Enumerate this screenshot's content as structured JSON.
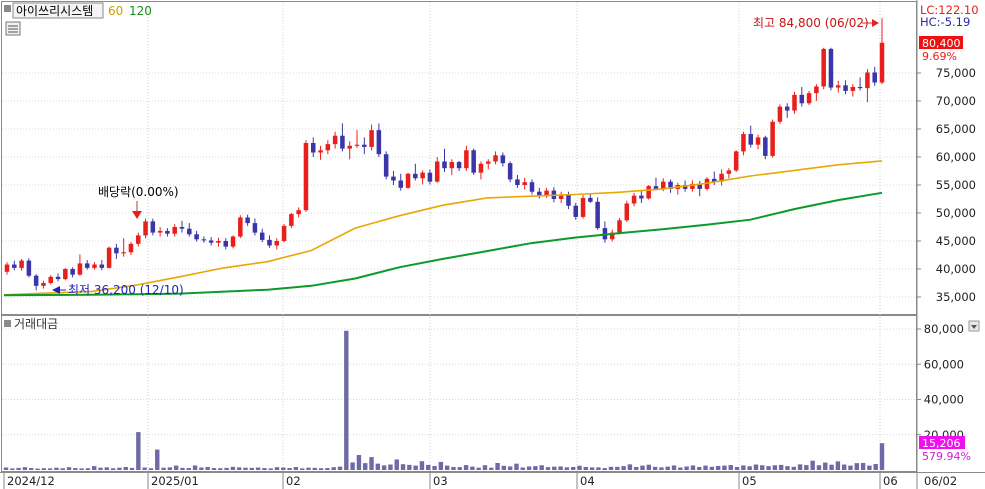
{
  "legend": {
    "stock_name": "아이쓰리시스템",
    "ma_short": "60",
    "ma_long": "120"
  },
  "price_panel": {
    "lc_label": "LC:122.10",
    "hc_label": "HC:-5.19",
    "current_price": "80,400",
    "change_pct": "9.69%",
    "high_annotation": "최고 84,800 (06/02)",
    "low_annotation": "최저 36,200 (12/10)",
    "dividend_annotation": "배당락(0.00%)"
  },
  "volume_panel": {
    "title": "거래대금",
    "current_value": "15,206",
    "change_pct": "579.94%"
  },
  "colors": {
    "up": "#e8201c",
    "down": "#3a35a8",
    "ma_short": "#e8a800",
    "ma_long": "#0c9a2a",
    "volume": "#6d6aa6",
    "highlight_price": "#ee1111",
    "highlight_volume": "#ee11ee"
  },
  "chart_data": {
    "type": "candlestick",
    "price_axis": {
      "ticks": [
        35000,
        40000,
        45000,
        50000,
        55000,
        60000,
        65000,
        70000,
        75000
      ],
      "tick_labels": [
        "35,000",
        "40,000",
        "45,000",
        "50,000",
        "55,000",
        "60,000",
        "65,000",
        "70,000",
        "75,000"
      ],
      "range": [
        33000,
        89000
      ]
    },
    "volume_axis": {
      "ticks": [
        20000,
        40000,
        60000,
        80000
      ],
      "tick_labels": [
        "20,000",
        "40,000",
        "60,000",
        "80,000"
      ],
      "range": [
        0,
        86000
      ]
    },
    "x_axis": {
      "labels": [
        "2024/12",
        "2025/01",
        "02",
        "03",
        "04",
        "05",
        "06",
        "06/02"
      ]
    },
    "candles": [
      [
        39500,
        41200,
        39000,
        40800
      ],
      [
        40800,
        41500,
        39800,
        40200
      ],
      [
        40200,
        41800,
        39700,
        41500
      ],
      [
        41500,
        41900,
        38500,
        38800
      ],
      [
        38800,
        39100,
        36200,
        37000
      ],
      [
        37000,
        37900,
        36500,
        37500
      ],
      [
        37500,
        38900,
        37200,
        38600
      ],
      [
        38600,
        39200,
        37800,
        38200
      ],
      [
        38200,
        40200,
        38000,
        40000
      ],
      [
        40000,
        40300,
        38500,
        39000
      ],
      [
        39000,
        42600,
        38800,
        41000
      ],
      [
        41000,
        41600,
        39900,
        40200
      ],
      [
        40200,
        41200,
        39900,
        40800
      ],
      [
        40800,
        41600,
        39800,
        40200
      ],
      [
        40200,
        44000,
        40100,
        43800
      ],
      [
        43800,
        44500,
        41800,
        42800
      ],
      [
        42800,
        45500,
        42200,
        43000
      ],
      [
        43000,
        44800,
        42500,
        44500
      ],
      [
        44500,
        46500,
        44000,
        46000
      ],
      [
        46000,
        49000,
        45500,
        48500
      ],
      [
        48500,
        49000,
        46000,
        46500
      ],
      [
        46500,
        47500,
        45800,
        46800
      ],
      [
        46800,
        47300,
        45800,
        46300
      ],
      [
        46300,
        48000,
        45800,
        47500
      ],
      [
        47500,
        48600,
        46500,
        47200
      ],
      [
        47200,
        48200,
        45800,
        46200
      ],
      [
        46200,
        46800,
        44900,
        45300
      ],
      [
        45300,
        45800,
        44700,
        45100
      ],
      [
        45100,
        45700,
        44200,
        44700
      ],
      [
        44700,
        45600,
        44000,
        45000
      ],
      [
        45000,
        45500,
        43500,
        44000
      ],
      [
        44000,
        46000,
        43700,
        45800
      ],
      [
        45800,
        49600,
        45500,
        49200
      ],
      [
        49200,
        49700,
        47700,
        48200
      ],
      [
        48200,
        49000,
        46000,
        46500
      ],
      [
        46500,
        47200,
        44800,
        45200
      ],
      [
        45200,
        46000,
        43800,
        44200
      ],
      [
        44200,
        45500,
        43500,
        45000
      ],
      [
        45000,
        48000,
        44800,
        47700
      ],
      [
        47700,
        50000,
        47300,
        49800
      ],
      [
        49800,
        51000,
        49200,
        50500
      ],
      [
        50500,
        63000,
        50200,
        62500
      ],
      [
        62500,
        63500,
        60000,
        60800
      ],
      [
        60800,
        62000,
        59500,
        61200
      ],
      [
        61200,
        63000,
        60500,
        62300
      ],
      [
        62300,
        64500,
        61500,
        63800
      ],
      [
        63800,
        66000,
        61000,
        61500
      ],
      [
        61500,
        62800,
        59600,
        62000
      ],
      [
        62000,
        64800,
        61600,
        62200
      ],
      [
        62200,
        63500,
        60500,
        61800
      ],
      [
        61800,
        65800,
        61200,
        64800
      ],
      [
        64800,
        66000,
        60000,
        60500
      ],
      [
        60500,
        61000,
        56000,
        56500
      ],
      [
        56500,
        57500,
        55000,
        55800
      ],
      [
        55800,
        57000,
        54000,
        54500
      ],
      [
        54500,
        57200,
        54300,
        57000
      ],
      [
        57000,
        58800,
        55800,
        56200
      ],
      [
        56200,
        57600,
        55100,
        57200
      ],
      [
        57200,
        57800,
        55100,
        55600
      ],
      [
        55600,
        60000,
        55400,
        59200
      ],
      [
        59200,
        61500,
        57300,
        58000
      ],
      [
        58000,
        59600,
        56800,
        59100
      ],
      [
        59100,
        59300,
        57500,
        58000
      ],
      [
        58000,
        62000,
        57500,
        61200
      ],
      [
        61200,
        61500,
        56800,
        57200
      ],
      [
        57200,
        59200,
        56000,
        58800
      ],
      [
        58800,
        59600,
        57800,
        59200
      ],
      [
        59200,
        61000,
        58700,
        60300
      ],
      [
        60300,
        60800,
        58300,
        58900
      ],
      [
        58900,
        59200,
        55500,
        56000
      ],
      [
        56000,
        56800,
        54500,
        55000
      ],
      [
        55000,
        56300,
        54200,
        55500
      ],
      [
        55500,
        56000,
        53300,
        53800
      ],
      [
        53800,
        54500,
        52600,
        53200
      ],
      [
        53200,
        54500,
        52700,
        54000
      ],
      [
        54000,
        54600,
        51900,
        52500
      ],
      [
        52500,
        53800,
        51800,
        53300
      ],
      [
        53300,
        53800,
        50700,
        51300
      ],
      [
        51300,
        51800,
        48800,
        49300
      ],
      [
        49300,
        53200,
        49000,
        52700
      ],
      [
        52700,
        53400,
        51800,
        52000
      ],
      [
        52000,
        52800,
        47000,
        47300
      ],
      [
        47300,
        48500,
        44700,
        45300
      ],
      [
        45300,
        47000,
        44900,
        46500
      ],
      [
        46500,
        49100,
        46200,
        48700
      ],
      [
        48700,
        52200,
        48400,
        51700
      ],
      [
        51700,
        53600,
        51200,
        53100
      ],
      [
        53100,
        54000,
        51800,
        52600
      ],
      [
        52600,
        55000,
        52400,
        54800
      ],
      [
        54800,
        56300,
        54000,
        54300
      ],
      [
        54300,
        56200,
        53900,
        55600
      ],
      [
        55600,
        56000,
        53600,
        54300
      ],
      [
        54300,
        55400,
        53300,
        55000
      ],
      [
        55000,
        55800,
        53800,
        54300
      ],
      [
        54300,
        55800,
        53800,
        55200
      ],
      [
        55200,
        55700,
        53000,
        54300
      ],
      [
        54300,
        56400,
        54000,
        56100
      ],
      [
        56100,
        57400,
        55000,
        55600
      ],
      [
        55600,
        57800,
        54900,
        57000
      ],
      [
        57000,
        58000,
        56200,
        57600
      ],
      [
        57600,
        61200,
        57300,
        61000
      ],
      [
        61000,
        64500,
        60300,
        64100
      ],
      [
        64100,
        65600,
        61700,
        62200
      ],
      [
        62200,
        64000,
        61400,
        63500
      ],
      [
        63500,
        63800,
        59600,
        60200
      ],
      [
        60200,
        66700,
        59900,
        66300
      ],
      [
        66300,
        69400,
        65900,
        69000
      ],
      [
        69000,
        69600,
        67000,
        68300
      ],
      [
        68300,
        71600,
        67700,
        71100
      ],
      [
        71100,
        72500,
        69000,
        69600
      ],
      [
        69600,
        71800,
        69300,
        71400
      ],
      [
        71400,
        73000,
        70000,
        72600
      ],
      [
        72600,
        79500,
        72100,
        79300
      ],
      [
        79300,
        79500,
        71900,
        72400
      ],
      [
        72400,
        73600,
        71500,
        72800
      ],
      [
        72800,
        73700,
        71200,
        71800
      ],
      [
        71800,
        73000,
        70800,
        72500
      ],
      [
        72500,
        74200,
        71900,
        72300
      ],
      [
        72300,
        75700,
        69800,
        75100
      ],
      [
        75100,
        76100,
        72700,
        73300
      ],
      [
        73300,
        84800,
        73000,
        80400
      ]
    ],
    "ma60": [
      [
        0,
        35400
      ],
      [
        0.05,
        35700
      ],
      [
        0.1,
        36000
      ],
      [
        0.15,
        37100
      ],
      [
        0.2,
        38600
      ],
      [
        0.25,
        40200
      ],
      [
        0.3,
        41300
      ],
      [
        0.35,
        43300
      ],
      [
        0.4,
        47300
      ],
      [
        0.45,
        49500
      ],
      [
        0.5,
        51400
      ],
      [
        0.55,
        52700
      ],
      [
        0.6,
        53000
      ],
      [
        0.65,
        53300
      ],
      [
        0.7,
        53700
      ],
      [
        0.75,
        54300
      ],
      [
        0.8,
        55300
      ],
      [
        0.85,
        56600
      ],
      [
        0.9,
        57600
      ],
      [
        0.95,
        58600
      ],
      [
        1.0,
        59300
      ]
    ],
    "ma120": [
      [
        0,
        35300
      ],
      [
        0.1,
        35400
      ],
      [
        0.2,
        35600
      ],
      [
        0.3,
        36300
      ],
      [
        0.35,
        37000
      ],
      [
        0.4,
        38300
      ],
      [
        0.45,
        40300
      ],
      [
        0.5,
        41800
      ],
      [
        0.55,
        43200
      ],
      [
        0.6,
        44600
      ],
      [
        0.65,
        45600
      ],
      [
        0.7,
        46400
      ],
      [
        0.75,
        47100
      ],
      [
        0.8,
        47900
      ],
      [
        0.85,
        48800
      ],
      [
        0.9,
        50700
      ],
      [
        0.95,
        52300
      ],
      [
        1.0,
        53600
      ]
    ],
    "volumes": [
      1400,
      900,
      1200,
      1600,
      1100,
      800,
      1000,
      900,
      1300,
      1000,
      1600,
      1100,
      900,
      1000,
      2200,
      1300,
      1500,
      1000,
      1300,
      1700,
      1200,
      21500,
      1400,
      1000,
      11600,
      1300,
      1500,
      2500,
      1200,
      1100,
      2600,
      1400,
      1700,
      1100,
      1000,
      1200,
      1800,
      1500,
      1300,
      1200,
      1400,
      1100,
      900,
      1600,
      1400,
      1100,
      1700,
      900,
      1300,
      1200,
      1000,
      1100,
      1600,
      1900,
      79000,
      4300,
      8500,
      3900,
      7300,
      3600,
      2600,
      3100,
      6000,
      3300,
      2900,
      2500,
      5000,
      2900,
      2300,
      4600,
      2500,
      1700,
      1600,
      2800,
      1900,
      1300,
      2700,
      1300,
      4000,
      2400,
      2000,
      3600,
      1400,
      2000,
      2200,
      2700,
      1600,
      1900,
      2000,
      1500,
      1700,
      2400,
      1700,
      1500,
      1500,
      1100,
      1800,
      1800,
      2200,
      3200,
      1700,
      2500,
      3000,
      1800,
      1500,
      1900,
      2600,
      1400,
      2000,
      2600,
      1700,
      2500,
      1800,
      2300,
      2500,
      2800,
      1700,
      2600,
      2100,
      3100,
      2700,
      2200,
      2700,
      2900,
      2200,
      1800,
      3200,
      2800,
      5300,
      2700,
      4200,
      3000,
      4900,
      3100,
      2500,
      3900,
      4000,
      2500,
      3400,
      15206
    ]
  }
}
